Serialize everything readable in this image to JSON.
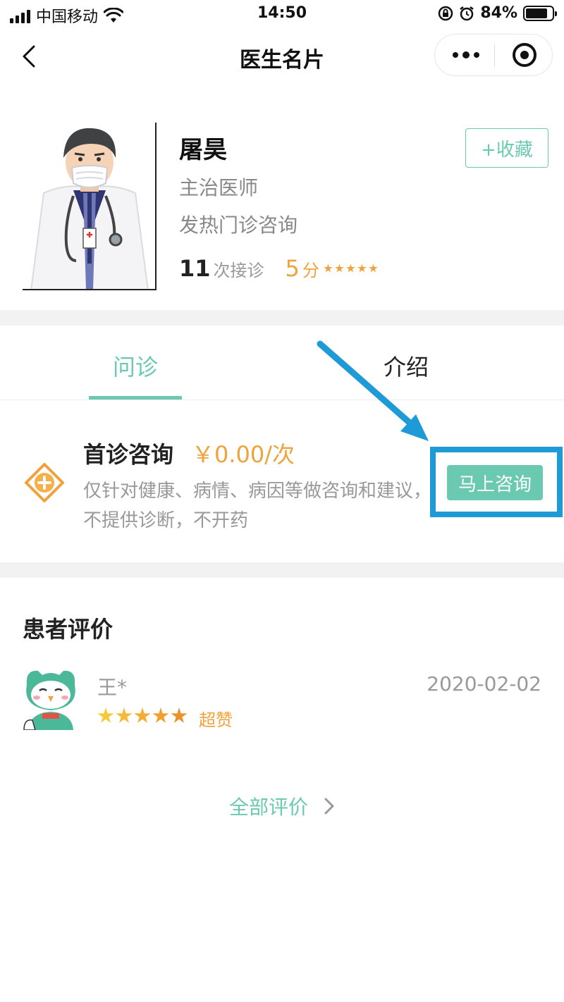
{
  "status_bar": {
    "carrier": "中国移动",
    "time": "14:50",
    "battery_pct": "84%",
    "battery_level": 0.84
  },
  "nav": {
    "title": "医生名片",
    "icons": [
      "back-arrow-icon",
      "more-dots-icon",
      "close-target-icon"
    ]
  },
  "doctor": {
    "name": "屠昊",
    "title": "主治医师",
    "department": "发热门诊咨询",
    "visit_count": "11",
    "visit_label": "次接诊",
    "score": "5",
    "score_label": "分",
    "rating_stars": 5,
    "favorite_label": "+收藏"
  },
  "tabs": [
    {
      "label": "问诊",
      "active": true
    },
    {
      "label": "介绍",
      "active": false
    }
  ],
  "consult": {
    "title": "首诊咨询",
    "price": "￥0.00/次",
    "description": "仅针对健康、病情、病因等做咨询和建议，不提供诊断，不开药",
    "button_label": "马上咨询",
    "icon": "medical-cross-icon"
  },
  "reviews": {
    "title": "患者评价",
    "items": [
      {
        "name": "王*",
        "date": "2020-02-02",
        "stars": 5,
        "tag": "超赞"
      }
    ],
    "all_label": "全部评价"
  },
  "colors": {
    "accent": "#6cc9b1",
    "price": "#f0a23b",
    "highlight": "#1e9ad6"
  }
}
